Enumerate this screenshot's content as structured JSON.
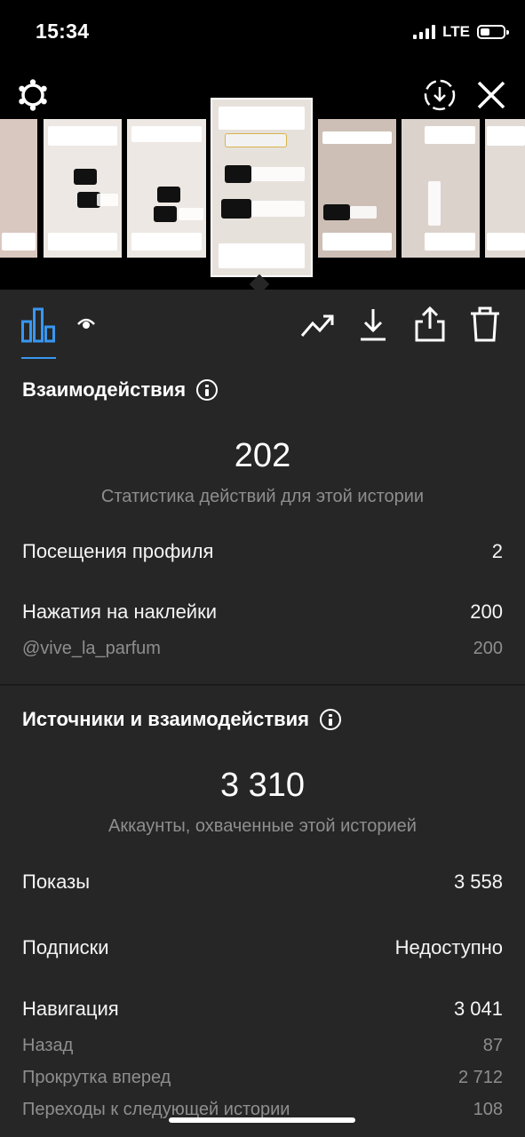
{
  "status": {
    "time": "15:34",
    "network": "LTE"
  },
  "stories": {
    "selected_tag": "@vive_la_parfum"
  },
  "tabs": [
    {
      "name": "insights",
      "icon": "bar-chart-icon",
      "active": true
    },
    {
      "name": "viewers",
      "icon": "eye-icon",
      "active": false
    }
  ],
  "actions": [
    "promote-icon",
    "download-icon",
    "share-icon",
    "trash-icon"
  ],
  "interactions": {
    "title": "Взаимодействия",
    "total": "202",
    "total_caption": "Статистика действий для этой истории",
    "profile_visits_label": "Посещения профиля",
    "profile_visits_value": "2",
    "sticker_taps_label": "Нажатия на наклейки",
    "sticker_taps_value": "200",
    "sticker_name": "@vive_la_parfum",
    "sticker_name_value": "200"
  },
  "discovery": {
    "title": "Источники и взаимодействия",
    "total": "3 310",
    "total_caption": "Аккаунты, охваченные этой историей",
    "impressions_label": "Показы",
    "impressions_value": "3 558",
    "follows_label": "Подписки",
    "follows_value": "Недоступно",
    "navigation_label": "Навигация",
    "navigation_value": "3 041",
    "back_label": "Назад",
    "back_value": "87",
    "forward_label": "Прокрутка вперед",
    "forward_value": "2 712",
    "next_story_label": "Переходы к следующей истории",
    "next_story_value": "108"
  },
  "colors": {
    "accent": "#3897f0",
    "panel": "#262626",
    "muted": "#8e8e8e"
  }
}
